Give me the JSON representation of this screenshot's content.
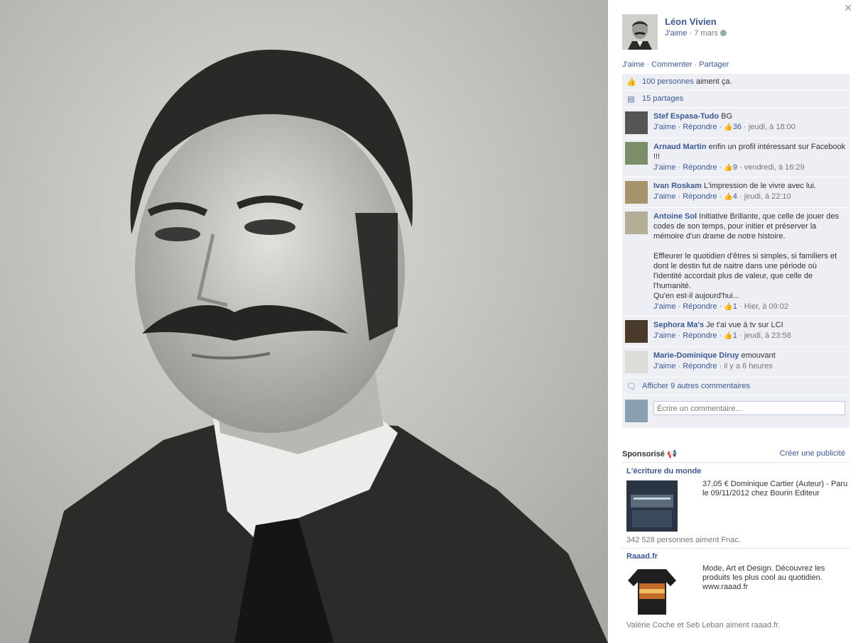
{
  "post": {
    "author": "Léon Vivien",
    "like_label": "J'aime",
    "meta_sep": " · ",
    "date": "7 mars",
    "actions": [
      "J'aime",
      "Commenter",
      "Partager"
    ],
    "likes_link": "100 personnes",
    "likes_suffix": " aiment ça.",
    "shares": "15 partages"
  },
  "comments": [
    {
      "name": "Stef Espasa-Tudo",
      "text": "BG",
      "like": "J'aime",
      "reply": "Répondre",
      "likes": "36",
      "time": "jeudi, à 18:00"
    },
    {
      "name": "Arnaud Martin",
      "text": "enfin un profil intéressant sur Facebook !!!",
      "like": "J'aime",
      "reply": "Répondre",
      "likes": "9",
      "time": "vendredi, à 16:29"
    },
    {
      "name": "Ivan Roskam",
      "text": "L'impression de le vivre avec lui.",
      "like": "J'aime",
      "reply": "Répondre",
      "likes": "4",
      "time": "jeudi, à 22:10"
    },
    {
      "name": "Antoine Sol",
      "text": "Initiative Brillante, que celle de jouer des codes de son temps, pour initier et préserver la mémoire d'un drame de notre histoire.",
      "text2": "Effleurer le quotidien d'êtres si simples, si familiers et dont le destin fut de naitre dans une période où l'identité accordait plus de valeur, que celle de l'humanité.",
      "text3": "Qu'en est-il aujourd'hui...",
      "like": "J'aime",
      "reply": "Répondre",
      "likes": "1",
      "time": "Hier, à 09:02"
    },
    {
      "name": "Sephora Ma's",
      "text": "Je t'ai vue à tv sur LCI",
      "like": "J'aime",
      "reply": "Répondre",
      "likes": "1",
      "time": "jeudi, à 23:58"
    },
    {
      "name": "Marie-Dominique Diruy",
      "text": "emouvant",
      "like": "J'aime",
      "reply": "Répondre",
      "time": "il y a 6 heures"
    }
  ],
  "more_comments": "Afficher 9 autres commentaires",
  "comment_placeholder": "Écrire un commentaire...",
  "sponsored": {
    "label": "Sponsorisé",
    "create": "Créer une publicité",
    "ads": [
      {
        "title": "L'écriture du monde",
        "body": "37,05 € Dominique Cartier (Auteur) - Paru le 09/11/2012 chez Bourin Editeur",
        "social": "342 528 personnes aiment Fnac."
      },
      {
        "title": "Raaad.fr",
        "body": "Mode, Art et Design. Découvrez les produits les plus cool au quotidien. www.raaad.fr",
        "social": "Valérie Coche et Seb Leban aiment raaad.fr."
      }
    ]
  },
  "icons": {
    "close": "close-icon",
    "globe": "globe-icon",
    "like": "thumbs-up-icon",
    "share": "share-icon",
    "comment": "comment-icon",
    "megaphone": "megaphone-icon"
  },
  "colors": {
    "link": "#3b5998",
    "ufi_bg": "#edeff4"
  }
}
